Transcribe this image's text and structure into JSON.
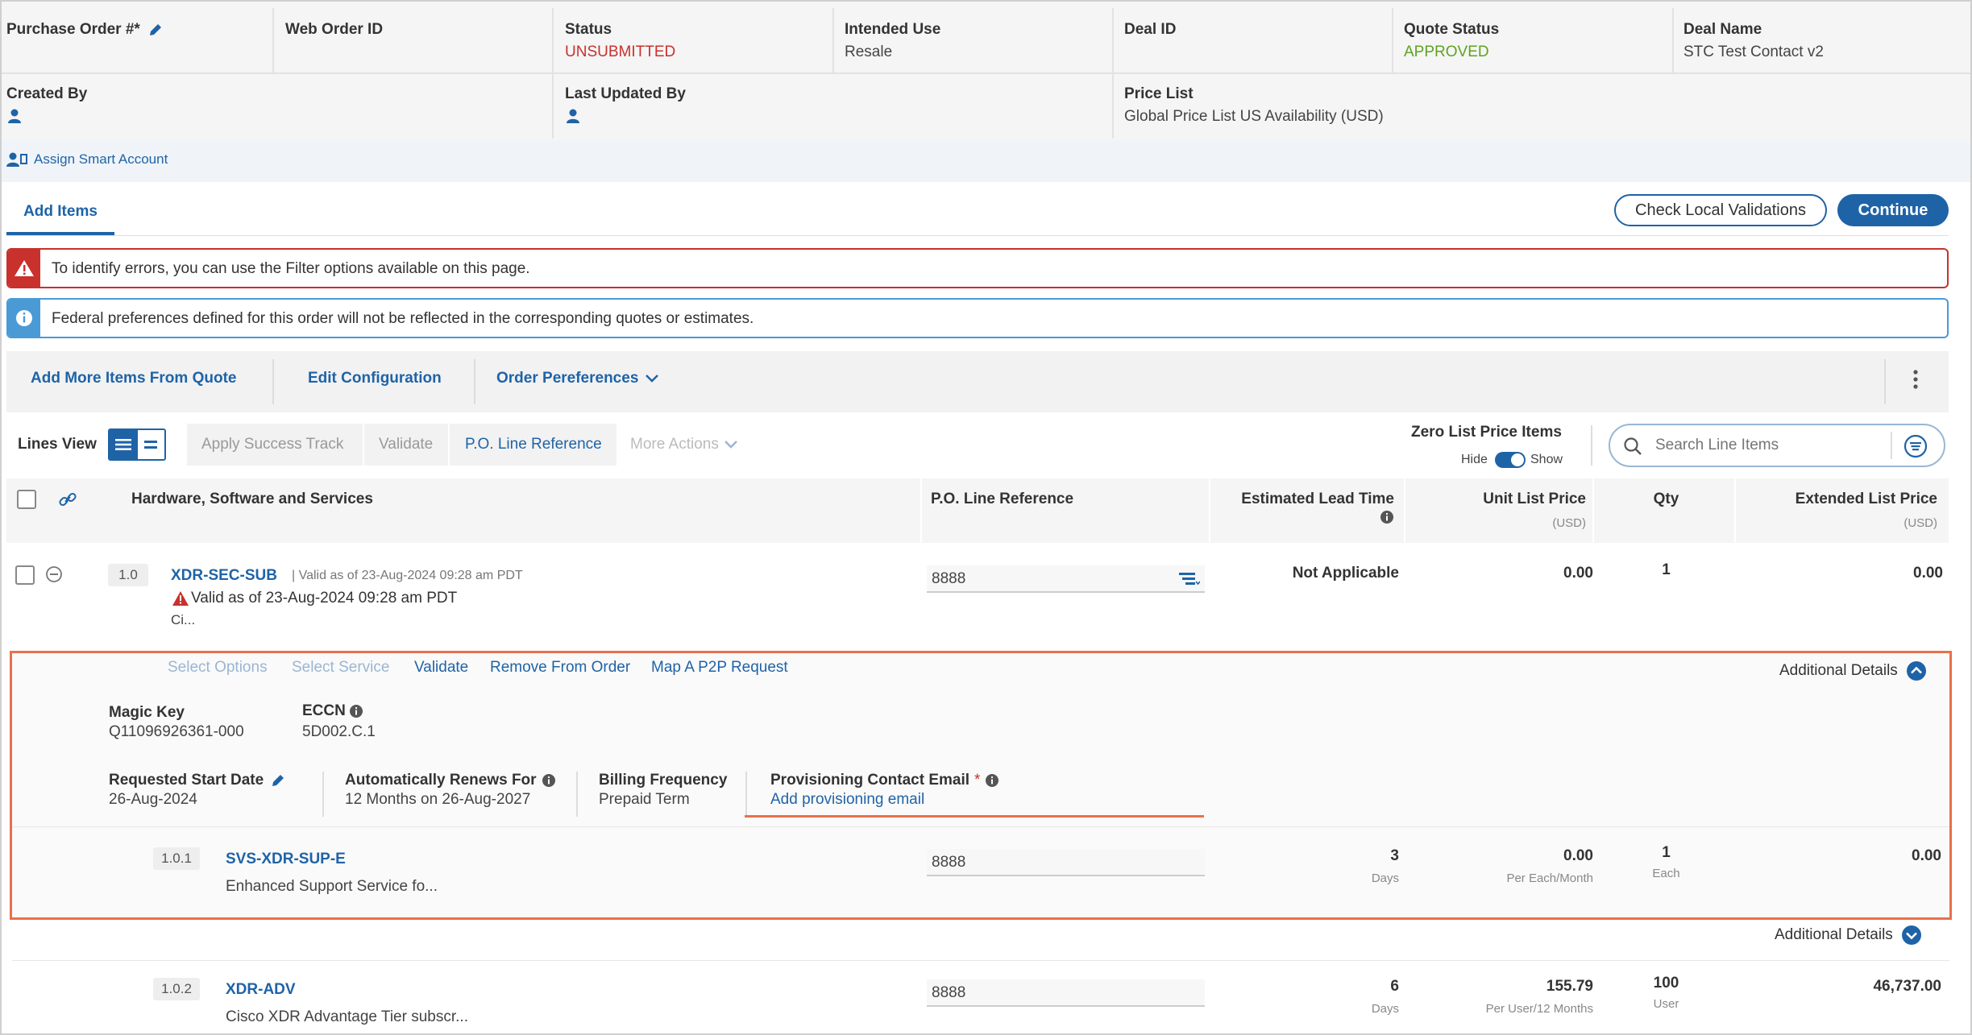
{
  "header": {
    "purchase_order_label": "Purchase Order #*",
    "web_order_label": "Web Order ID",
    "status_label": "Status",
    "status_value": "UNSUBMITTED",
    "intended_use_label": "Intended Use",
    "intended_use_value": "Resale",
    "deal_id_label": "Deal ID",
    "quote_status_label": "Quote Status",
    "quote_status_value": "APPROVED",
    "deal_name_label": "Deal Name",
    "deal_name_value": "STC Test Contact v2",
    "created_by_label": "Created By",
    "last_updated_label": "Last Updated By",
    "price_list_label": "Price List",
    "price_list_value": "Global Price List US Availability (USD)",
    "assign_smart_account": "Assign Smart Account"
  },
  "tabs": {
    "add_items": "Add Items"
  },
  "buttons": {
    "check_local": "Check Local Validations",
    "continue": "Continue"
  },
  "alerts": {
    "error": "To identify errors, you can use the Filter options available on this page.",
    "info": "Federal preferences defined for this order will not be reflected in the corresponding quotes or estimates."
  },
  "action_bar": {
    "add_more": "Add More Items From Quote",
    "edit_config": "Edit Configuration",
    "order_prefs": "Order Pereferences"
  },
  "toolbar": {
    "lines_view": "Lines View",
    "apply_success": "Apply Success Track",
    "validate": "Validate",
    "po_line_ref": "P.O. Line Reference",
    "more_actions": "More Actions",
    "zero_list_label": "Zero List Price Items",
    "hide": "Hide",
    "show": "Show",
    "search_placeholder": "Search Line Items"
  },
  "columns": {
    "hw": "Hardware, Software and Services",
    "po_ref": "P.O. Line Reference",
    "lead_time": "Estimated Lead Time",
    "unit_price": "Unit List Price",
    "unit_price_sub": "(USD)",
    "qty": "Qty",
    "ext_price": "Extended List Price",
    "ext_price_sub": "(USD)"
  },
  "line1": {
    "num": "1.0",
    "sku": "XDR-SEC-SUB",
    "valid_small": "Valid as of 23-Aug-2024 09:28 am PDT",
    "valid_warn": "Valid as of 23-Aug-2024 09:28 am PDT",
    "desc": "Ci...",
    "po_ref": "8888",
    "lead_time": "Not Applicable",
    "unit_price": "0.00",
    "qty": "1",
    "ext_price": "0.00"
  },
  "details": {
    "select_options": "Select Options",
    "select_service": "Select Service",
    "validate": "Validate",
    "remove": "Remove From Order",
    "map_p2p": "Map A P2P Request",
    "additional_details": "Additional Details",
    "magic_key_label": "Magic Key",
    "magic_key_value": "Q11096926361-000",
    "eccn_label": "ECCN",
    "eccn_value": "5D002.C.1",
    "req_start_label": "Requested Start Date",
    "req_start_value": "26-Aug-2024",
    "auto_renew_label": "Automatically Renews For",
    "auto_renew_value": "12 Months on 26-Aug-2027",
    "billing_label": "Billing Frequency",
    "billing_value": "Prepaid Term",
    "prov_label": "Provisioning Contact Email",
    "prov_required": "*",
    "prov_link": "Add provisioning email"
  },
  "line101": {
    "num": "1.0.1",
    "sku": "SVS-XDR-SUP-E",
    "desc": "Enhanced Support Service fo...",
    "po_ref": "8888",
    "lead_time": "3",
    "lead_unit": "Days",
    "unit_price": "0.00",
    "unit_sub": "Per Each/Month",
    "qty": "1",
    "qty_unit": "Each",
    "ext_price": "0.00"
  },
  "additional_details_2": "Additional Details",
  "line102": {
    "num": "1.0.2",
    "sku": "XDR-ADV",
    "desc": "Cisco XDR Advantage Tier subscr...",
    "po_ref": "8888",
    "lead_time": "6",
    "lead_unit": "Days",
    "unit_price": "155.79",
    "unit_sub": "Per User/12 Months",
    "qty": "100",
    "qty_unit": "User",
    "ext_price": "46,737.00"
  },
  "colors": {
    "accent": "#1f63a7",
    "error": "#c8312c",
    "success": "#5ea31f",
    "highlight": "#e8704a"
  }
}
